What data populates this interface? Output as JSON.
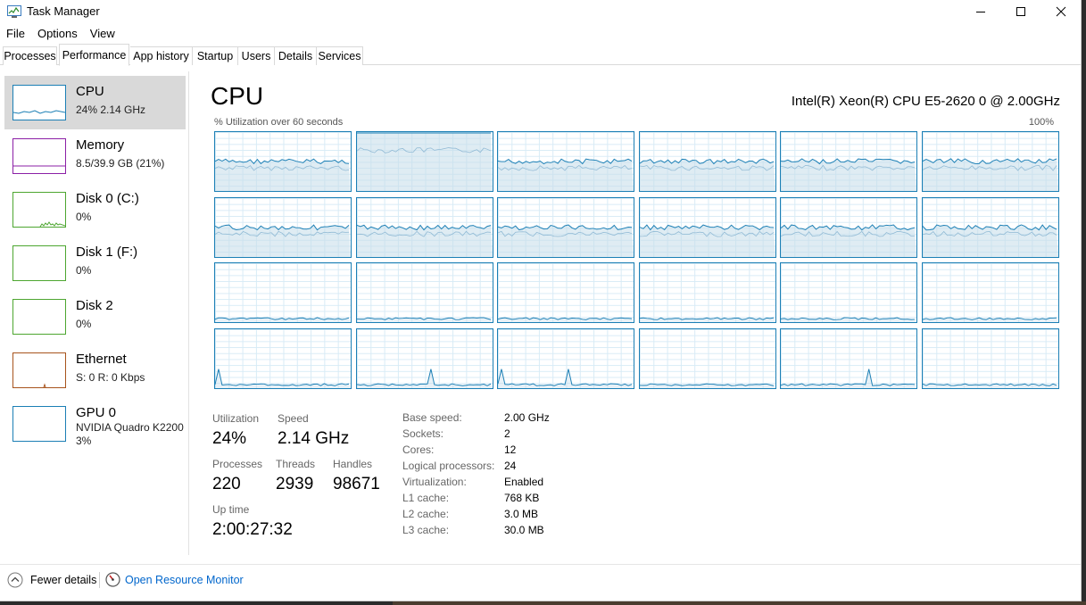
{
  "window": {
    "title": "Task Manager"
  },
  "menu": [
    "File",
    "Options",
    "View"
  ],
  "tabs": [
    "Processes",
    "Performance",
    "App history",
    "Startup",
    "Users",
    "Details",
    "Services"
  ],
  "active_tab": "Performance",
  "sidebar": [
    {
      "title": "CPU",
      "sub1": "24%  2.14 GHz",
      "sub2": "",
      "color": "#1b7fb5",
      "selected": true
    },
    {
      "title": "Memory",
      "sub1": "8.5/39.9 GB (21%)",
      "sub2": "",
      "color": "#8b1fa6",
      "selected": false
    },
    {
      "title": "Disk 0 (C:)",
      "sub1": "0%",
      "sub2": "",
      "color": "#4da630",
      "selected": false
    },
    {
      "title": "Disk 1 (F:)",
      "sub1": "0%",
      "sub2": "",
      "color": "#4da630",
      "selected": false
    },
    {
      "title": "Disk 2",
      "sub1": "0%",
      "sub2": "",
      "color": "#4da630",
      "selected": false
    },
    {
      "title": "Ethernet",
      "sub1": "S: 0  R: 0 Kbps",
      "sub2": "",
      "color": "#a7531c",
      "selected": false
    },
    {
      "title": "GPU 0",
      "sub1": "NVIDIA Quadro K2200",
      "sub2": "3%",
      "color": "#1b7fb5",
      "selected": false
    }
  ],
  "main": {
    "title": "CPU",
    "model": "Intel(R) Xeon(R) CPU E5-2620 0 @ 2.00GHz",
    "graph_caption": "% Utilization over 60 seconds",
    "graph_max": "100%",
    "line_color": "#1b7fb5",
    "fill_color": "#c5dcea",
    "logical_processor_count": 24
  },
  "stats": {
    "utilization_label": "Utilization",
    "utilization": "24%",
    "speed_label": "Speed",
    "speed": "2.14 GHz",
    "processes_label": "Processes",
    "processes": "220",
    "threads_label": "Threads",
    "threads": "2939",
    "handles_label": "Handles",
    "handles": "98671",
    "uptime_label": "Up time",
    "uptime": "2:00:27:32"
  },
  "specs": [
    {
      "key": "Base speed:",
      "value": "2.00 GHz"
    },
    {
      "key": "Sockets:",
      "value": "2"
    },
    {
      "key": "Cores:",
      "value": "12"
    },
    {
      "key": "Logical processors:",
      "value": "24"
    },
    {
      "key": "Virtualization:",
      "value": "Enabled"
    },
    {
      "key": "L1 cache:",
      "value": "768 KB"
    },
    {
      "key": "L2 cache:",
      "value": "3.0 MB"
    },
    {
      "key": "L3 cache:",
      "value": "30.0 MB"
    }
  ],
  "footer": {
    "fewer_details": "Fewer details",
    "open_monitor": "Open Resource Monitor"
  }
}
